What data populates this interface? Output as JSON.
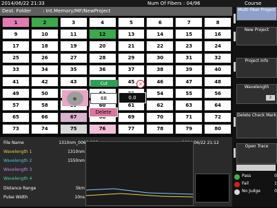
{
  "status_bar": {
    "datetime": "2014/06/22 21:33",
    "fibers": "Num Of Fibers : 04/96",
    "course": "Course"
  },
  "path_bar": {
    "label": "Dest. Folder",
    "path": ": Int.Memory/MF/NewProject"
  },
  "grid": {
    "cells": [
      "1",
      "2",
      "3",
      "4",
      "5",
      "6",
      "7",
      "8",
      "9",
      "10",
      "11",
      "12",
      "13",
      "14",
      "15",
      "16",
      "17",
      "18",
      "19",
      "20",
      "21",
      "22",
      "23",
      "24",
      "25",
      "26",
      "27",
      "28",
      "29",
      "30",
      "31",
      "32",
      "33",
      "34",
      "35",
      "36",
      "37",
      "38",
      "39",
      "40",
      "41",
      "42",
      "43",
      "44",
      "45",
      "46",
      "47",
      "48",
      "49",
      "50",
      "51",
      "52",
      "53",
      "54",
      "55",
      "56",
      "57",
      "58",
      "59",
      "60",
      "61",
      "62",
      "63",
      "64",
      "65",
      "66",
      "67",
      "68",
      "69",
      "70",
      "71",
      "72",
      "73",
      "74",
      "75",
      "76",
      "77",
      "78",
      "79",
      "80"
    ]
  },
  "grid_overlays": {
    "green_label": "Cut",
    "white_value": "68",
    "dark_value": "0.0",
    "delete_label": "Delete",
    "red_symbol": "×"
  },
  "right_panel": {
    "multi_fiber_project": "Multi Fiber Project",
    "new_project": "New Project",
    "project_info": "Project Info",
    "wavelength": "Wavelength",
    "wavelength_tag": "2",
    "delete_check_mark": "Delete Check Mark",
    "open_trace": "Open Trace"
  },
  "legend": {
    "pass": "Pass",
    "pass_value": "0",
    "fail": "Fail",
    "fail_value": "1",
    "nojudge": "No Judge",
    "nojudge_value": "0"
  },
  "bottom_info": {
    "file_name_label": "File Name",
    "file_name_value": "1310nm_0068.SOR",
    "timestamp": "2014/06/22 21:12",
    "w1_label": "Wavelength 1",
    "w1_value": "1310nm",
    "w2_label": "Wavelength 2",
    "w2_value": "1550nm",
    "w3_label": "Wavelength 3",
    "w3_value": "",
    "w4_label": "Wavelength 4",
    "w4_value": "",
    "distance_label": "Distance Range",
    "distance_value": "5km",
    "pulse_label": "Pulse Width",
    "pulse_value": "10ns"
  },
  "colors": {
    "pink": "#e37ab3",
    "green": "#3da84c",
    "delete": "#d8779f",
    "trace_bg": "#1b1b1b"
  }
}
